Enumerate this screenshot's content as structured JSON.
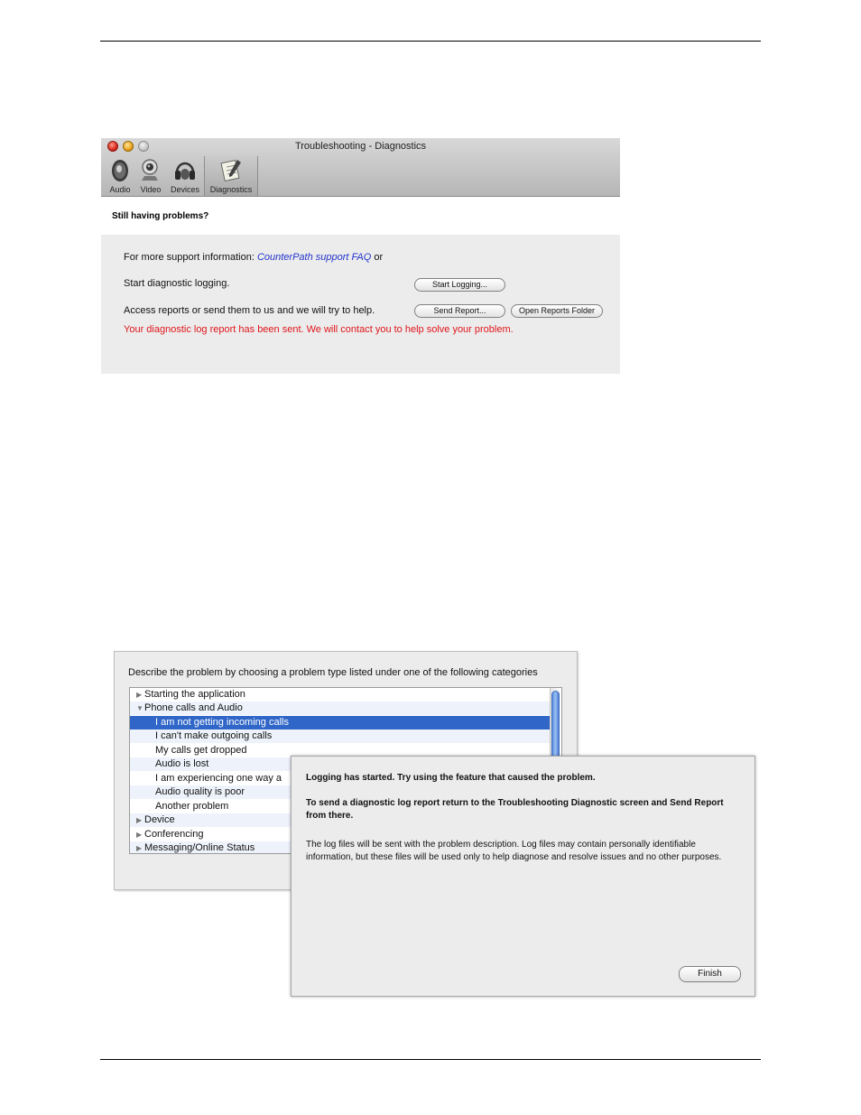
{
  "diagnostics_window": {
    "title": "Troubleshooting - Diagnostics",
    "toolbar": [
      {
        "label": "Audio",
        "icon": "speaker-icon"
      },
      {
        "label": "Video",
        "icon": "webcam-icon"
      },
      {
        "label": "Devices",
        "icon": "headset-icon"
      },
      {
        "label": "Diagnostics",
        "icon": "notepad-icon"
      }
    ],
    "heading": "Still having problems?",
    "support_prefix": "For more support information: ",
    "support_link": "CounterPath support FAQ",
    "support_suffix": "or",
    "logging_label": "Start diagnostic logging.",
    "start_logging_button": "Start Logging...",
    "reports_label": "Access reports or send them to us and we will try to help.",
    "send_report_button": "Send Report...",
    "open_folder_button": "Open Reports Folder",
    "status_message": "Your diagnostic log report has been sent. We will contact you to help solve your problem.",
    "status_color": "#e0151b"
  },
  "problem_window": {
    "instruction": "Describe the problem by choosing a problem type listed under one of the following categories",
    "tree": [
      {
        "label": "Starting the application",
        "expander": "▶"
      },
      {
        "label": "Phone calls and Audio",
        "expander": "▼"
      },
      {
        "label": "I am not getting incoming calls"
      },
      {
        "label": "I can't make outgoing calls"
      },
      {
        "label": "My calls get dropped"
      },
      {
        "label": "Audio is lost"
      },
      {
        "label": "I am experiencing one way a"
      },
      {
        "label": "Audio quality is poor"
      },
      {
        "label": "Another problem"
      },
      {
        "label": "Device",
        "expander": "▶"
      },
      {
        "label": "Conferencing",
        "expander": "▶"
      },
      {
        "label": "Messaging/Online Status",
        "expander": "▶"
      }
    ],
    "selection_color": "#2f66c8"
  },
  "logging_dialog": {
    "line1": "Logging has started. Try using the feature that caused the problem.",
    "line2": "To send a diagnostic log report return to the Troubleshooting Diagnostic screen and Send Report from there.",
    "line3": "The log files will be sent with the problem description. Log files may contain personally identifiable information, but these files will be used only to help diagnose and resolve issues and no other purposes.",
    "finish_button": "Finish"
  }
}
